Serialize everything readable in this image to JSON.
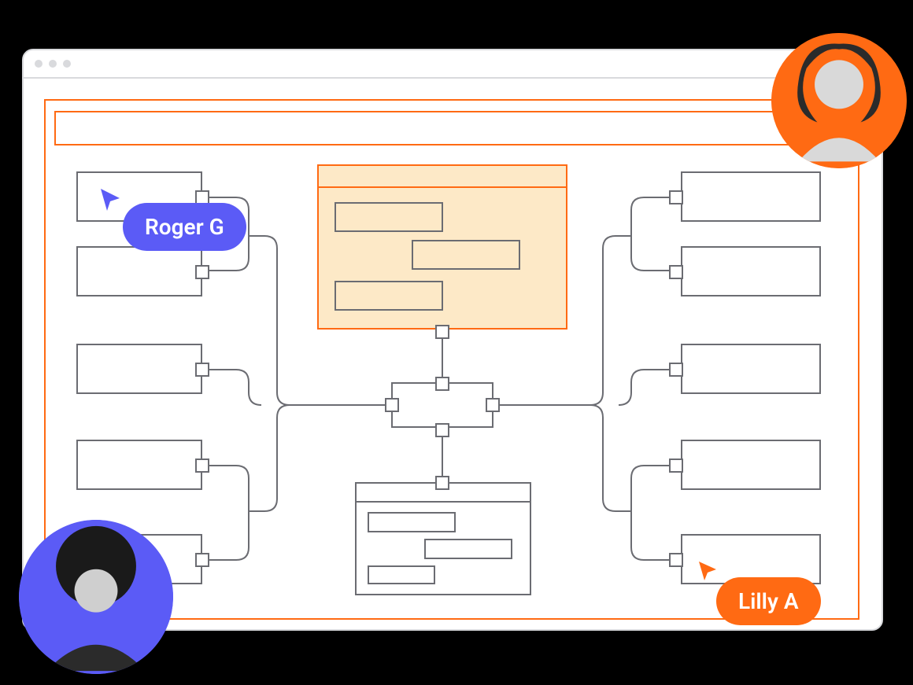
{
  "cursors": {
    "roger": {
      "label": "Roger G",
      "color": "#5b5bf6"
    },
    "lilly": {
      "label": "Lilly A",
      "color": "#ff6a13"
    }
  },
  "colors": {
    "accent_orange": "#ff6a13",
    "accent_blue": "#5b5bf6",
    "stroke_gray": "#6b6c72",
    "panel_fill": "#fde9c7"
  },
  "window": {
    "traffic_lights": 3
  },
  "diagram": {
    "left_nodes": 5,
    "right_nodes": 5,
    "center_panel": {
      "bars": 3,
      "highlighted": true
    },
    "bottom_panel": {
      "bars": 3
    }
  }
}
